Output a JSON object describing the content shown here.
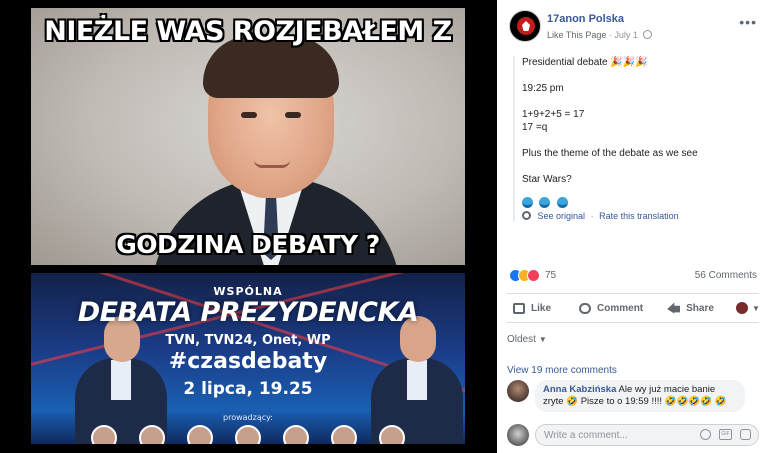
{
  "viewer": {
    "meme": {
      "top_text": "NIEŻLE WAS ROZJEBAŁEM Z",
      "bottom_text": "GODZINA DEBATY ?"
    },
    "debate": {
      "kicker": "WSPÓLNA",
      "title": "DEBATA PREZYDENCKA",
      "channels": "TVN, TVN24, Onet, WP",
      "hashtag": "#czasdebaty",
      "date": "2 lipca, 19.25",
      "hosts_label": "prowadzący:"
    }
  },
  "post": {
    "page_name": "17anon Polska",
    "like_link": "Like This Page",
    "date": "July 1",
    "lines": [
      "Presidential debate 🎉🎉🎉",
      "19:25 pm",
      "1+9+2+5 = 17",
      "17 =q",
      "Plus the theme of the debate as we see",
      "Star Wars?"
    ],
    "see_original": "See original",
    "rate_translation": "Rate this translation",
    "reaction_count": "75",
    "comments_count": "56 Comments",
    "actions": {
      "like": "Like",
      "comment": "Comment",
      "share": "Share"
    },
    "sort_label": "Oldest",
    "view_more": "View 19 more comments",
    "comment": {
      "author": "Anna Kabzińska",
      "text": "Ale wy już macie banie zryte 🤣 Pisze to o 19:59 !!!! 🤣🤣🤣🤣 🤣"
    },
    "composer_placeholder": "Write a comment..."
  },
  "colors": {
    "link": "#385898",
    "secondary_text": "#606770",
    "like_blue": "#1877f2",
    "haha_yellow": "#f7b125",
    "love_red": "#f33e58"
  },
  "icons": [
    "globe-icon",
    "more-icon",
    "wave-icon",
    "gear-icon",
    "like-icon",
    "comment-icon",
    "share-icon",
    "emoji-icon",
    "gif-icon",
    "sticker-icon"
  ]
}
